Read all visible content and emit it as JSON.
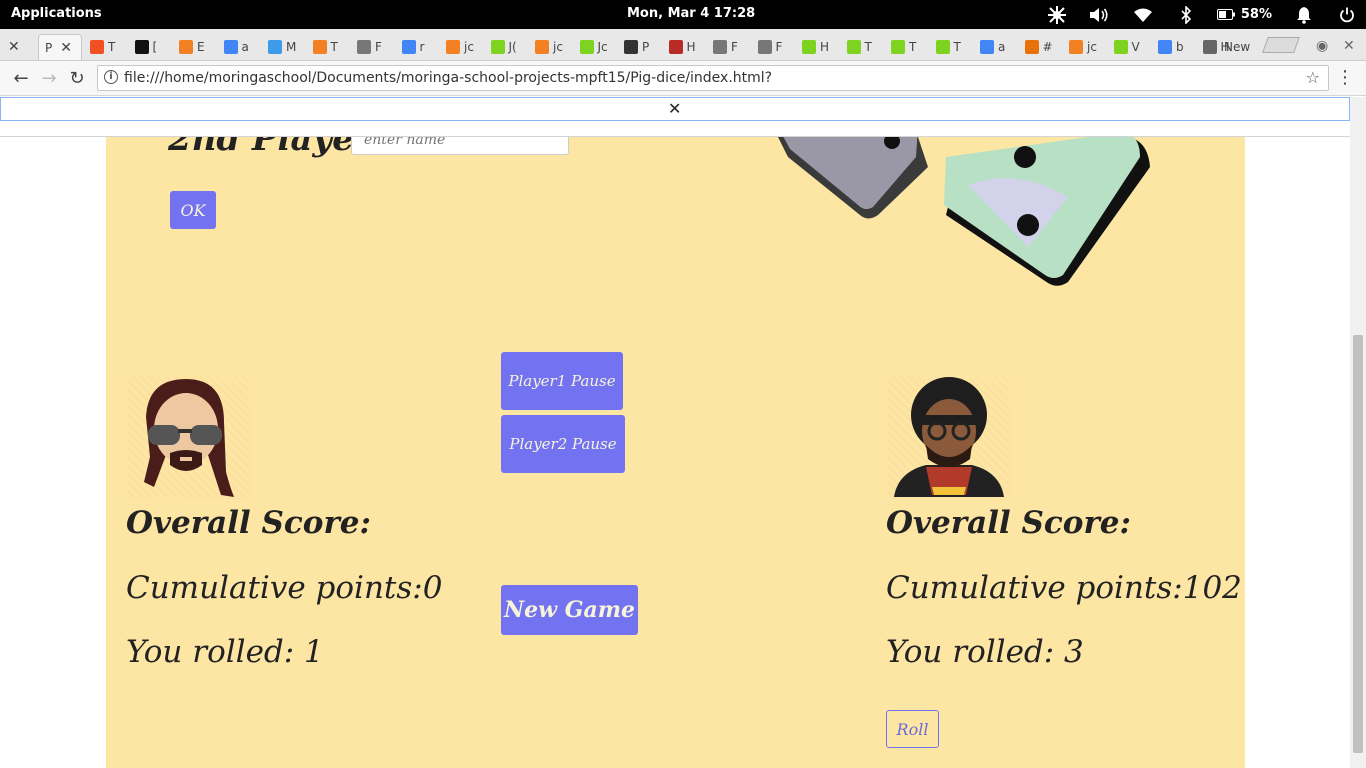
{
  "topbar": {
    "activities_label": "Applications",
    "clock": "Mon, Mar 4   17:28",
    "battery_percent": "58%",
    "icons": [
      "accessibility-icon",
      "volume-icon",
      "wifi-icon",
      "bluetooth-icon",
      "battery-icon",
      "bell-icon",
      "power-icon"
    ]
  },
  "tabs": {
    "active_label": "P",
    "newtab_label": "New",
    "items": [
      {
        "label": "T",
        "color": "#f25022"
      },
      {
        "label": "[",
        "color": "#111111"
      },
      {
        "label": "E",
        "color": "#f48024"
      },
      {
        "label": "a",
        "color": "#4285f4"
      },
      {
        "label": "M",
        "color": "#3d9be9"
      },
      {
        "label": "T",
        "color": "#f48024"
      },
      {
        "label": "F",
        "color": "#777777"
      },
      {
        "label": "r",
        "color": "#4285f4"
      },
      {
        "label": "jc",
        "color": "#f48024"
      },
      {
        "label": "J(",
        "color": "#7ed321"
      },
      {
        "label": "jc",
        "color": "#f48024"
      },
      {
        "label": "Jc",
        "color": "#7ed321"
      },
      {
        "label": "P",
        "color": "#333333"
      },
      {
        "label": "H",
        "color": "#b92b27"
      },
      {
        "label": "F",
        "color": "#777777"
      },
      {
        "label": "F",
        "color": "#777777"
      },
      {
        "label": "H",
        "color": "#7ed321"
      },
      {
        "label": "T",
        "color": "#7ed321"
      },
      {
        "label": "T",
        "color": "#7ed321"
      },
      {
        "label": "T",
        "color": "#7ed321"
      },
      {
        "label": "a",
        "color": "#4285f4"
      },
      {
        "label": "#",
        "color": "#e8710a"
      },
      {
        "label": "jc",
        "color": "#f48024"
      },
      {
        "label": "V",
        "color": "#7ed321"
      },
      {
        "label": "b",
        "color": "#4285f4"
      },
      {
        "label": "H",
        "color": "#666666"
      }
    ]
  },
  "address": {
    "url": "file:///home/moringaschool/Documents/moringa-school-projects-mpft15/Pig-dice/index.html?"
  },
  "findbar": {
    "close_label": "✕"
  },
  "page": {
    "player2_label": "2nd Player:",
    "name_placeholder": "enter name",
    "ok_label": "OK",
    "pause1_label": "Player1 Pause",
    "pause2_label": "Player2 Pause",
    "new_game_label": "New Game",
    "roll_label": "Roll",
    "player1": {
      "overall_label": "Overall Score:",
      "cumulative_label": "Cumulative points:0",
      "rolled_label": "You rolled: 1"
    },
    "player2": {
      "overall_label": "Overall Score:",
      "cumulative_label": "Cumulative points:102",
      "rolled_label": "You rolled: 3"
    }
  },
  "colors": {
    "page_bg": "#fde5a4",
    "button_bg": "#7373f2",
    "button_text": "#f7f4d8"
  }
}
